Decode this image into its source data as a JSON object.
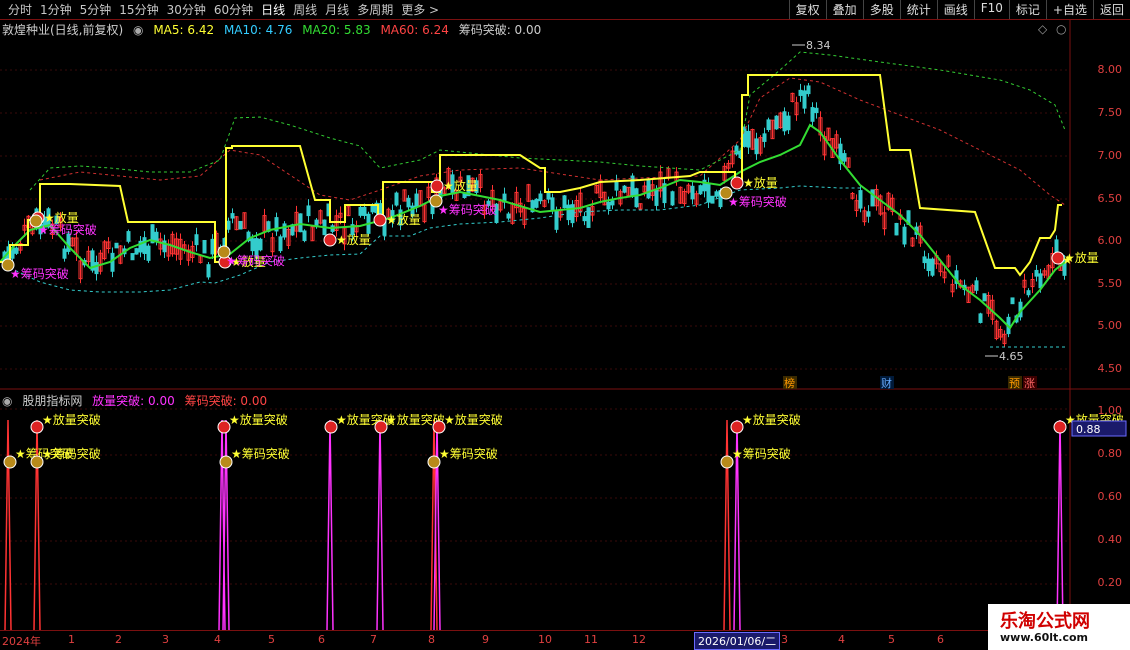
{
  "toolbar": {
    "periods": [
      "分时",
      "1分钟",
      "5分钟",
      "15分钟",
      "30分钟",
      "60分钟",
      "日线",
      "周线",
      "月线",
      "多周期",
      "更多 >"
    ],
    "active_period": "日线",
    "right_buttons": [
      "复权",
      "叠加",
      "多股",
      "统计",
      "画线",
      "F10",
      "标记",
      "+自选",
      "返回"
    ]
  },
  "main_legend": {
    "stock": "敦煌种业(日线,前复权)",
    "ma5": "MA5: 6.42",
    "ma10": "MA10: 4.76",
    "ma20": "MA20: 5.83",
    "ma60": "MA60: 6.24",
    "chip": "筹码突破: 0.00"
  },
  "sub_legend": {
    "name": "股朋指标网",
    "volume": "放量突破: 0.00",
    "chip": "筹码突破: 0.00"
  },
  "price_axis": [
    "8.00",
    "7.50",
    "7.00",
    "6.50",
    "6.00",
    "5.50",
    "5.00",
    "4.50"
  ],
  "ind_axis": [
    "1.00",
    "0.80",
    "0.60",
    "0.40",
    "0.20"
  ],
  "current_value": "0.88",
  "high_label": "8.34",
  "low_label": "4.65",
  "signals": {
    "volume": "放量",
    "chip": "筹码突破",
    "volume_break": "放量突破"
  },
  "markers": {
    "bang": "榜",
    "cai": "财",
    "yu": "预",
    "zhang": "涨"
  },
  "dates": [
    "2024年",
    "1",
    "2",
    "3",
    "4",
    "5",
    "6",
    "7",
    "8",
    "9",
    "10",
    "11",
    "12",
    "3",
    "4",
    "5",
    "6"
  ],
  "selected_date": "2026/01/06/二",
  "watermark": {
    "title": "乐淘公式网",
    "url": "www.60lt.com"
  },
  "colors": {
    "ma5": "#ffff33",
    "ma10": "#33ccff",
    "ma20": "#33dd33",
    "ma60": "#ff4444",
    "signal": "#ff33ff",
    "axis": "#e04040"
  }
}
